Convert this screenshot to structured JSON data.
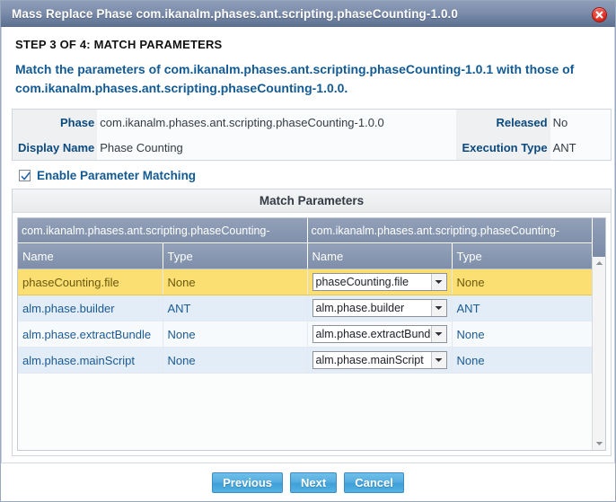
{
  "window": {
    "title": "Mass Replace Phase com.ikanalm.phases.ant.scripting.phaseCounting-1.0.0",
    "close_icon": "close-icon"
  },
  "header": {
    "step": "STEP 3 OF 4: MATCH PARAMETERS",
    "description": "Match the parameters of com.ikanalm.phases.ant.scripting.phaseCounting-1.0.1 with those of com.ikanalm.phases.ant.scripting.phaseCounting-1.0.0."
  },
  "info": {
    "phase_label": "Phase",
    "phase_value": "com.ikanalm.phases.ant.scripting.phaseCounting-1.0.0",
    "released_label": "Released",
    "released_value": "No",
    "display_name_label": "Display Name",
    "display_name_value": "Phase Counting",
    "execution_type_label": "Execution Type",
    "execution_type_value": "ANT"
  },
  "enable_matching": {
    "label": "Enable Parameter Matching",
    "checked": true,
    "check_icon": "check-icon"
  },
  "grid": {
    "panel_title": "Match Parameters",
    "group_headers": [
      "com.ikanalm.phases.ant.scripting.phaseCounting-",
      "com.ikanalm.phases.ant.scripting.phaseCounting-"
    ],
    "columns": [
      "Name",
      "Type",
      "Name",
      "Type"
    ],
    "rows": [
      {
        "source_name": "phaseCounting.file",
        "source_type": "None",
        "target_name": "phaseCounting.file",
        "target_type": "None",
        "selected": true
      },
      {
        "source_name": "alm.phase.builder",
        "source_type": "ANT",
        "target_name": "alm.phase.builder",
        "target_type": "ANT",
        "selected": false
      },
      {
        "source_name": "alm.phase.extractBundle",
        "source_type": "None",
        "target_name": "alm.phase.extractBundle",
        "target_type": "None",
        "selected": false
      },
      {
        "source_name": "alm.phase.mainScript",
        "source_type": "None",
        "target_name": "alm.phase.mainScript",
        "target_type": "None",
        "selected": false
      }
    ],
    "scroll_up_icon": "scroll-up-icon",
    "scroll_down_icon": "scroll-down-icon",
    "dropdown_icon": "chevron-down-icon"
  },
  "footer": {
    "previous": "Previous",
    "next": "Next",
    "cancel": "Cancel"
  },
  "colors": {
    "titlebar": "#7f90ae",
    "accent_blue": "#125a94",
    "selected_row": "#fbdf72",
    "alt_row": "#e2edf7",
    "button": "#4fabdf",
    "close": "#e03127"
  }
}
